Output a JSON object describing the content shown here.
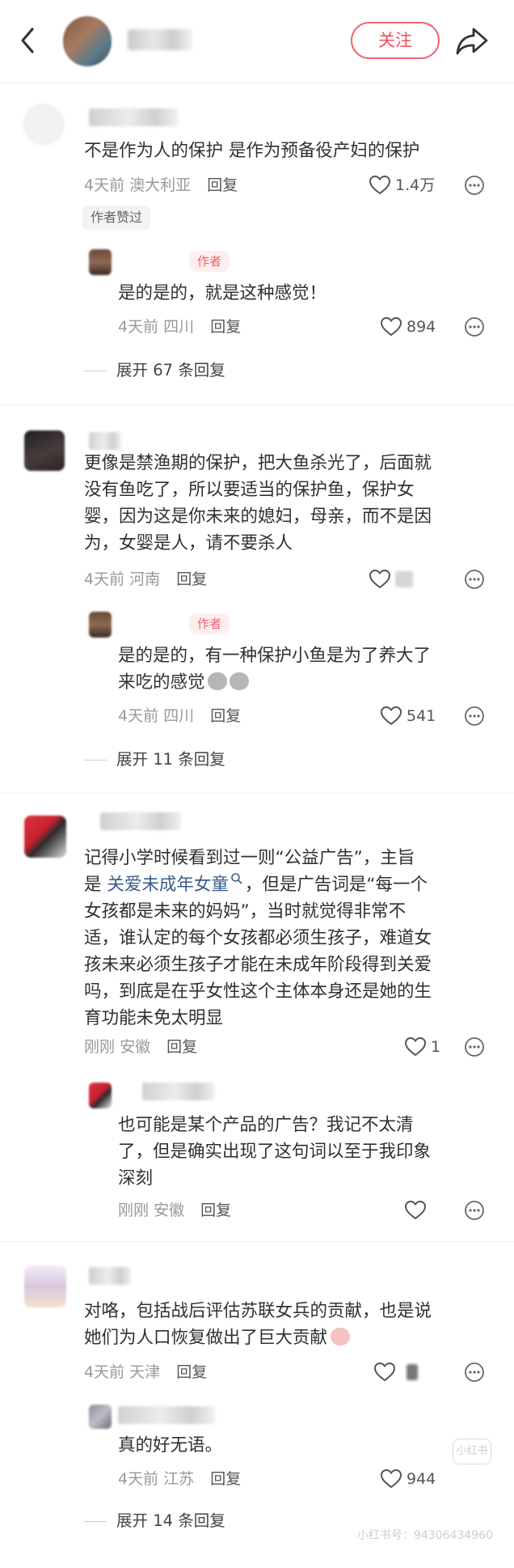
{
  "header": {
    "follow_label": "关注"
  },
  "comments": [
    {
      "content": [
        "不是作为人的保护 是作为预备役产妇的保护"
      ],
      "time": "4天前",
      "location": "澳大利亚",
      "reply_label": "回复",
      "likes": "1.4万",
      "liked_badge": "作者赞过",
      "replies": [
        {
          "author_tag": "作者",
          "content": [
            "是的是的，就是这种感觉！"
          ],
          "time": "4天前",
          "location": "四川",
          "reply_label": "回复",
          "likes": "894"
        }
      ],
      "expand_label": "展开 67 条回复"
    },
    {
      "content": [
        "更像是禁渔期的保护，把大鱼杀光了，后面就",
        "没有鱼吃了，所以要适当的保护鱼，保护女",
        "婴，因为这是你未来的媳妇，母亲，而不是因",
        "为，女婴是人，请不要杀人"
      ],
      "time": "4天前",
      "location": "河南",
      "reply_label": "回复",
      "replies": [
        {
          "author_tag": "作者",
          "content": [
            "是的是的，有一种保护小鱼是为了养大了",
            "来吃的感觉"
          ],
          "time": "4天前",
          "location": "四川",
          "reply_label": "回复",
          "likes": "541"
        }
      ],
      "expand_label": "展开 11 条回复"
    },
    {
      "content": [
        "记得小学时候看到过一则“公益广告”，主旨",
        "但是广告词是“每一个",
        "女孩都是未来的妈妈”，当时就觉得非常不",
        "适，谁认定的每个女孩都必须生孩子，难道女",
        "孩未来必须生孩子才能在未成年阶段得到关爱",
        "吗，到底是在乎女性这个主体本身还是她的生",
        "育功能未免太明显"
      ],
      "content_line2_prefix": "是 ",
      "content_link": "关爱未成年女童",
      "content_line2_sep": "，",
      "time": "刚刚",
      "location": "安徽",
      "reply_label": "回复",
      "likes": "1",
      "replies": [
        {
          "content": [
            "也可能是某个产品的广告？我记不太清",
            "了，但是确实出现了这句词以至于我印象",
            "深刻"
          ],
          "time": "刚刚",
          "location": "安徽",
          "reply_label": "回复"
        }
      ]
    },
    {
      "content": [
        "对咯，包括战后评估苏联女兵的贡献，也是说",
        "她们为人口恢复做出了巨大贡献"
      ],
      "time": "4天前",
      "location": "天津",
      "reply_label": "回复",
      "replies": [
        {
          "content": [
            "真的好无语。"
          ],
          "time": "4天前",
          "location": "江苏",
          "reply_label": "回复",
          "likes": "944"
        }
      ],
      "expand_label": "展开 14 条回复"
    }
  ],
  "watermark": {
    "logo_text": "小红书",
    "id_text": "小红书号：94306434960"
  },
  "colors": {
    "accent": "#ee4d5c",
    "link": "#3b5c8c",
    "meta": "#999999"
  }
}
